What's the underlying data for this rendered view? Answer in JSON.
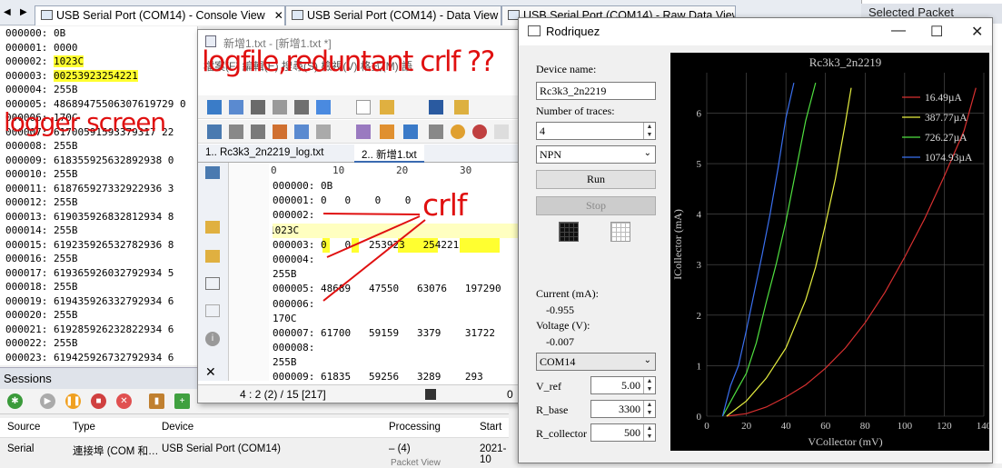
{
  "tabs": [
    {
      "label": "USB Serial Port (COM14) - Console View"
    },
    {
      "label": "USB Serial Port (COM14) - Data View"
    },
    {
      "label": "USB Serial Port (COM14) - Raw Data View"
    }
  ],
  "selected_packet_label": "Selected Packet",
  "console_rows": [
    {
      "text": "000000: 0B"
    },
    {
      "text": "000001: 0000"
    },
    {
      "text": "000002: 1023C"
    },
    {
      "text": "000003: 00253923254221"
    },
    {
      "text": "000004: 255B"
    },
    {
      "text": "000005: 48689475506307619729 0"
    },
    {
      "text": "000006: 170C"
    },
    {
      "text": "000007: 61700591593379317 22"
    },
    {
      "text": "000008: 255B"
    },
    {
      "text": "000009: 618355925632892938 0"
    },
    {
      "text": "000010: 255B"
    },
    {
      "text": "000011: 618765927332922936 3"
    },
    {
      "text": "000012: 255B"
    },
    {
      "text": "000013: 619035926832812934 8"
    },
    {
      "text": "000014: 255B"
    },
    {
      "text": "000015: 619235926532782936 8"
    },
    {
      "text": "000016: 255B"
    },
    {
      "text": "000017: 619365926032792934 5"
    },
    {
      "text": "000018: 255B"
    },
    {
      "text": "000019: 619435926332792934 6"
    },
    {
      "text": "000020: 255B"
    },
    {
      "text": "000021: 619285926232822934 6"
    },
    {
      "text": "000022: 255B"
    },
    {
      "text": "000023: 619425926732792934 6"
    }
  ],
  "sessions": {
    "title": "Sessions",
    "columns": [
      "Source",
      "Type",
      "Device",
      "Processing",
      "Start"
    ],
    "row": [
      "Serial",
      "連接埠 (COM 和…",
      "USB Serial Port (COM14)",
      "– (4)",
      "2021-10"
    ],
    "processing_sub": "Packet View"
  },
  "notepad": {
    "title": "新增1.txt - [新增1.txt *]",
    "menu": "檔案(F)  編輯(E)  搜尋(S)  檢視(V)  格式(M)  語",
    "doc_tabs": [
      "1.. Rc3k3_2n2219_log.txt",
      "2.. 新增1.txt"
    ],
    "ruler": [
      "0",
      "10",
      "20",
      "30"
    ],
    "lines": [
      "000000: 0B",
      "000001: 0   0    0    0",
      "000002:",
      "1023C",
      "000003: 0   0   253923   254221",
      "000004:",
      "255B",
      "000005: 48689   47550   63076   197290",
      "000006:",
      "170C",
      "000007: 61700   59159   3379    31722",
      "000008:",
      "255B",
      "000009: 61835   59256   3289    293"
    ],
    "status": "4 : 2 (2) / 15  [217]",
    "status_right": "0"
  },
  "rodriquez": {
    "title": "Rodriquez",
    "device_name_label": "Device name:",
    "device_name_value": "Rc3k3_2n2219",
    "num_traces_label": "Number of traces:",
    "num_traces_value": "4",
    "type_value": "NPN",
    "run_label": "Run",
    "stop_label": "Stop",
    "current_label": "Current (mA):",
    "current_value": "-0.955",
    "voltage_label": "Voltage (V):",
    "voltage_value": "-0.007",
    "port_value": "COM14",
    "vref_label": "V_ref",
    "vref_value": "5.00",
    "rbase_label": "R_base",
    "rbase_value": "3300",
    "rcoll_label": "R_collector",
    "rcoll_value": "500"
  },
  "annotations": {
    "logger": "logger screen",
    "logfile": "logfile,reduntant crlf ??",
    "crlf": "crlf"
  },
  "chart_data": {
    "type": "line",
    "title": "Rc3k3_2n2219",
    "xlabel": "VCollector (mV)",
    "ylabel": "ICollector (mA)",
    "xlim": [
      0,
      140
    ],
    "ylim": [
      0,
      6.8
    ],
    "xticks": [
      0,
      20,
      40,
      60,
      80,
      100,
      120,
      140
    ],
    "yticks": [
      0,
      1,
      2,
      3,
      4,
      5,
      6
    ],
    "legend_position": "top-right",
    "series": [
      {
        "name": "16.49µA",
        "color": "#d83030",
        "x": [
          10,
          20,
          30,
          40,
          50,
          60,
          70,
          80,
          90,
          100,
          110,
          120,
          130,
          136
        ],
        "y": [
          0.0,
          0.05,
          0.18,
          0.38,
          0.62,
          0.95,
          1.35,
          1.85,
          2.45,
          3.15,
          3.9,
          4.75,
          5.65,
          6.5
        ]
      },
      {
        "name": "387.77µA",
        "color": "#e8f040",
        "x": [
          10,
          20,
          30,
          40,
          50,
          55,
          60,
          65,
          70,
          73
        ],
        "y": [
          0.0,
          0.3,
          0.75,
          1.35,
          2.3,
          2.95,
          3.8,
          4.7,
          5.8,
          6.5
        ]
      },
      {
        "name": "726.27µA",
        "color": "#50e040",
        "x": [
          8,
          15,
          20,
          25,
          30,
          35,
          40,
          45,
          50,
          55
        ],
        "y": [
          0.0,
          0.5,
          0.85,
          1.45,
          2.25,
          3.0,
          3.85,
          4.85,
          5.85,
          6.6
        ]
      },
      {
        "name": "1074.93µA",
        "color": "#3a70f0",
        "x": [
          8,
          12,
          16,
          20,
          24,
          28,
          32,
          36,
          40,
          44
        ],
        "y": [
          0.0,
          0.6,
          1.0,
          1.7,
          2.45,
          3.2,
          4.0,
          4.9,
          5.9,
          6.6
        ]
      }
    ]
  }
}
